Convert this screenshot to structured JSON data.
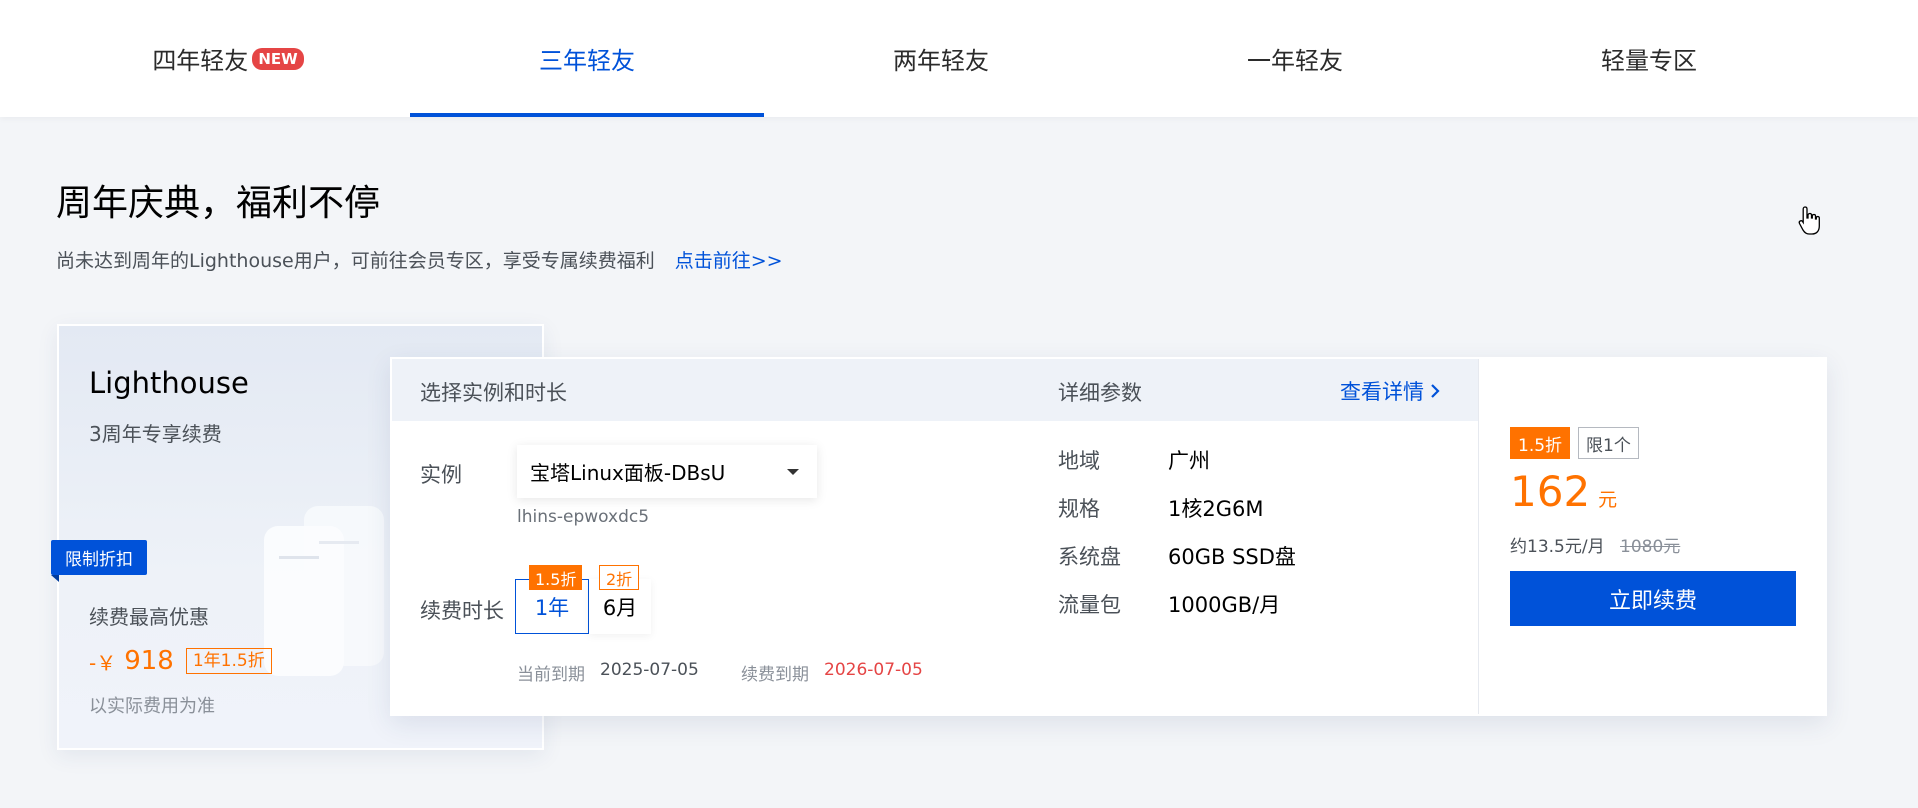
{
  "tabs": [
    {
      "label": "四年轻友",
      "badge": "NEW",
      "active": false
    },
    {
      "label": "三年轻友",
      "active": true
    },
    {
      "label": "两年轻友",
      "active": false
    },
    {
      "label": "一年轻友",
      "active": false
    },
    {
      "label": "轻量专区",
      "active": false
    }
  ],
  "headline": "周年庆典，福利不停",
  "subline": {
    "text": "尚未达到周年的Lighthouse用户，可前往会员专区，享受专属续费福利",
    "link": "点击前往>>"
  },
  "left_card": {
    "title": "Lighthouse",
    "subtitle": "3周年专享续费",
    "ribbon": "限制折扣",
    "offer_label": "续费最高优惠",
    "price_prefix": "-￥",
    "price": "918",
    "price_tag": "1年1.5折",
    "note": "以实际费用为准"
  },
  "main_card": {
    "header": {
      "select_label": "选择实例和时长",
      "params_label": "详细参数",
      "details_link": "查看详情"
    },
    "instance": {
      "label": "实例",
      "selected": "宝塔Linux面板-DBsU",
      "id": "lhins-epwoxdc5"
    },
    "duration": {
      "label": "续费时长",
      "options": [
        {
          "label": "1年",
          "tag": "1.5折",
          "selected": true
        },
        {
          "label": "6月",
          "tag": "2折",
          "selected": false
        }
      ]
    },
    "expiry": {
      "current_label": "当前到期",
      "current_value": "2025-07-05",
      "renew_label": "续费到期",
      "renew_value": "2026-07-05"
    },
    "specs": [
      {
        "key": "地域",
        "value": "广州"
      },
      {
        "key": "规格",
        "value": "1核2G6M"
      },
      {
        "key": "系统盘",
        "value": "60GB SSD盘"
      },
      {
        "key": "流量包",
        "value": "1000GB/月"
      }
    ],
    "price_panel": {
      "discount_tag": "1.5折",
      "limit_tag": "限1个",
      "price": "162",
      "unit": "元",
      "monthly": "约13.5元/月",
      "original": "1080元",
      "button": "立即续费"
    }
  },
  "colors": {
    "accent": "#0052d9",
    "orange": "#ff7200",
    "red": "#e54545"
  }
}
